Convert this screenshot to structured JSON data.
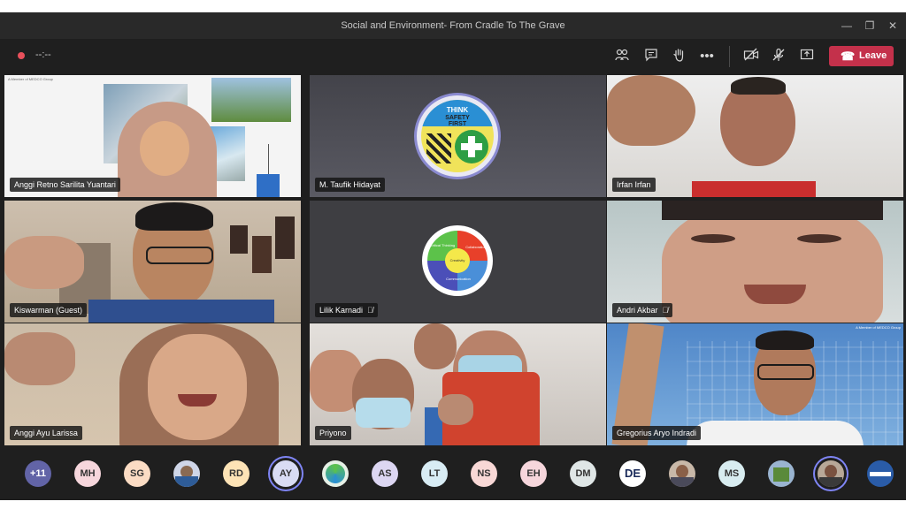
{
  "window": {
    "title": "Social and Environment- From Cradle To The Grave"
  },
  "toolbar": {
    "timer": "--:--",
    "leave_label": "Leave"
  },
  "tiles": [
    {
      "name": "Anggi Retno Sarilita Yuantari"
    },
    {
      "name": "M. Taufik Hidayat"
    },
    {
      "name": "Irfan Irfan"
    },
    {
      "name": "Kiswarman (Guest)"
    },
    {
      "name": "Lilik Karnadi"
    },
    {
      "name": "Andri Akbar"
    },
    {
      "name": "Anggi Ayu Larissa"
    },
    {
      "name": "Priyono"
    },
    {
      "name": "Gregorius Aryo Indradi"
    }
  ],
  "badge_think": {
    "top": "THINK",
    "mid": "SAFETY",
    "bot": "FIRST"
  },
  "logo_4c": {
    "q1": "Critical Thinking",
    "q2": "Collaboration",
    "q3": "Communication",
    "center": "Creativity"
  },
  "slide_header": "A Member of MEDCO Group",
  "roster": {
    "overflow": "+11",
    "initials": [
      "MH",
      "SG",
      "RD",
      "AY",
      "AS",
      "LT",
      "NS",
      "EH",
      "DM",
      "MS"
    ],
    "logo_text": "DE"
  },
  "colors": {
    "accent": "#7f85f5",
    "leave": "#c4314b",
    "overflow": "#6264a7"
  }
}
